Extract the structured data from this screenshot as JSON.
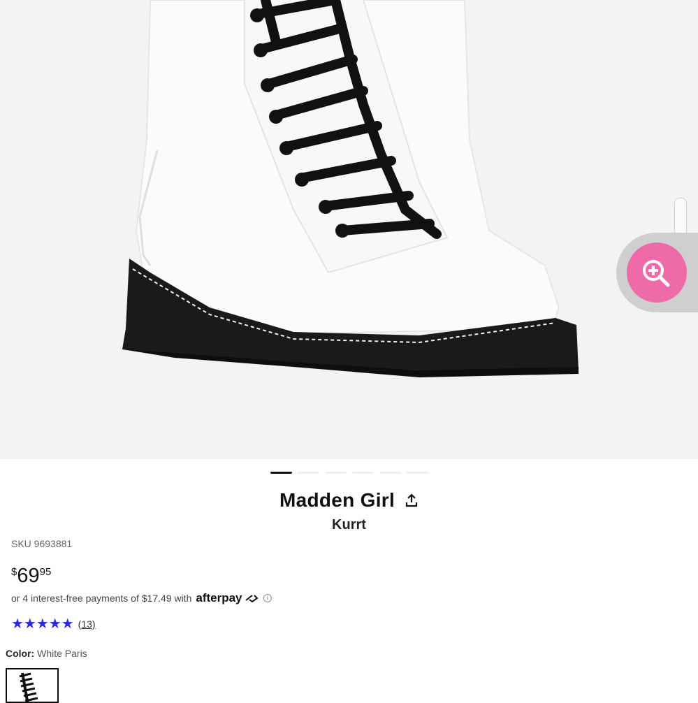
{
  "product": {
    "brand": "Madden Girl",
    "model": "Kurrt",
    "sku": "SKU 9693881",
    "price": {
      "currency": "$",
      "dollars": "69",
      "cents": "95"
    },
    "afterpay": {
      "text": "or 4 interest-free payments of $17.49 with",
      "logo": "afterpay",
      "info": "i"
    },
    "rating": {
      "stars": "★★★★★",
      "count": "(13)",
      "value": 5
    },
    "color": {
      "label": "Color:",
      "value": "White Paris"
    }
  },
  "gallery": {
    "total_images": 6,
    "active_index": 0
  },
  "icons": {
    "zoom": "zoom-in-icon",
    "share": "share-icon"
  },
  "colors": {
    "zoom_button": "#ef6aa8",
    "star": "#2f2ad8",
    "hero_bg": "#f3f3f3"
  }
}
